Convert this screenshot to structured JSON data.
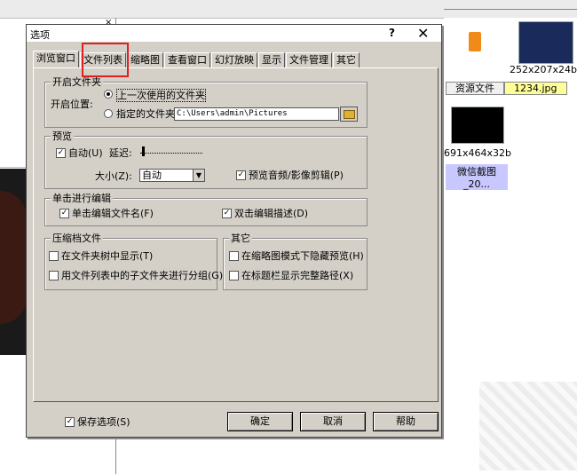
{
  "background": {
    "thumbnails": [
      {
        "label": "252x207x24b"
      },
      {
        "label": "691x464x32b"
      }
    ],
    "thumb_tabs": [
      "资源文件",
      "1234.jpg"
    ],
    "selected_file": "微信截图_20..."
  },
  "dialog": {
    "title": "选项",
    "help_glyph": "?",
    "close_glyph": "✕",
    "tabs": [
      "浏览窗口",
      "文件列表",
      "缩略图",
      "查看窗口",
      "幻灯放映",
      "显示",
      "文件管理",
      "其它"
    ],
    "open_folder": {
      "group_title": "开启文件夹",
      "location_label": "开启位置:",
      "option_last": "上一次使用的文件夹",
      "option_specified": "指定的文件夹:",
      "path_value": "C:\\Users\\admin\\Pictures"
    },
    "preview": {
      "group_title": "预览",
      "auto_label": "自动(U)",
      "delay_label": "延迟:",
      "size_label": "大小(Z):",
      "size_value": "自动",
      "audio_label": "预览音频/影像剪辑(P)"
    },
    "single_click": {
      "group_title": "单击进行编辑",
      "edit_filename": "单击编辑文件名(F)",
      "edit_description": "双击编辑描述(D)"
    },
    "archive": {
      "group_title": "压缩档文件",
      "show_in_tree": "在文件夹树中显示(T)",
      "group_subfolders": "用文件列表中的子文件夹进行分组(G)"
    },
    "other": {
      "group_title": "其它",
      "hide_preview": "在缩略图模式下隐藏预览(H)",
      "full_path": "在标题栏显示完整路径(X)"
    },
    "save_options": "保存选项(S)",
    "buttons": {
      "ok": "确定",
      "cancel": "取消",
      "help": "帮助"
    }
  }
}
